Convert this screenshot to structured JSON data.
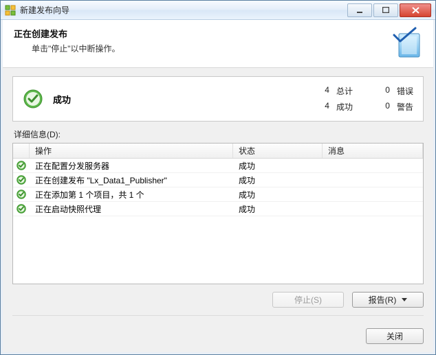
{
  "window": {
    "title": "新建发布向导"
  },
  "header": {
    "title": "正在创建发布",
    "subtitle": "单击\"停止\"以中断操作。"
  },
  "summary": {
    "status": "成功",
    "total_count": "4",
    "total_label": "总计",
    "success_count": "4",
    "success_label": "成功",
    "error_count": "0",
    "error_label": "错误",
    "warning_count": "0",
    "warning_label": "警告"
  },
  "details_label": "详细信息(D):",
  "columns": {
    "op": "操作",
    "status": "状态",
    "msg": "消息"
  },
  "rows": [
    {
      "op": "正在配置分发服务器",
      "status": "成功",
      "msg": ""
    },
    {
      "op": "正在创建发布 \"Lx_Data1_Publisher\"",
      "status": "成功",
      "msg": ""
    },
    {
      "op": "正在添加第 1 个项目，共 1 个",
      "status": "成功",
      "msg": ""
    },
    {
      "op": "正在启动快照代理",
      "status": "成功",
      "msg": ""
    }
  ],
  "buttons": {
    "stop": "停止(S)",
    "report": "报告(R)",
    "close": "关闭"
  }
}
